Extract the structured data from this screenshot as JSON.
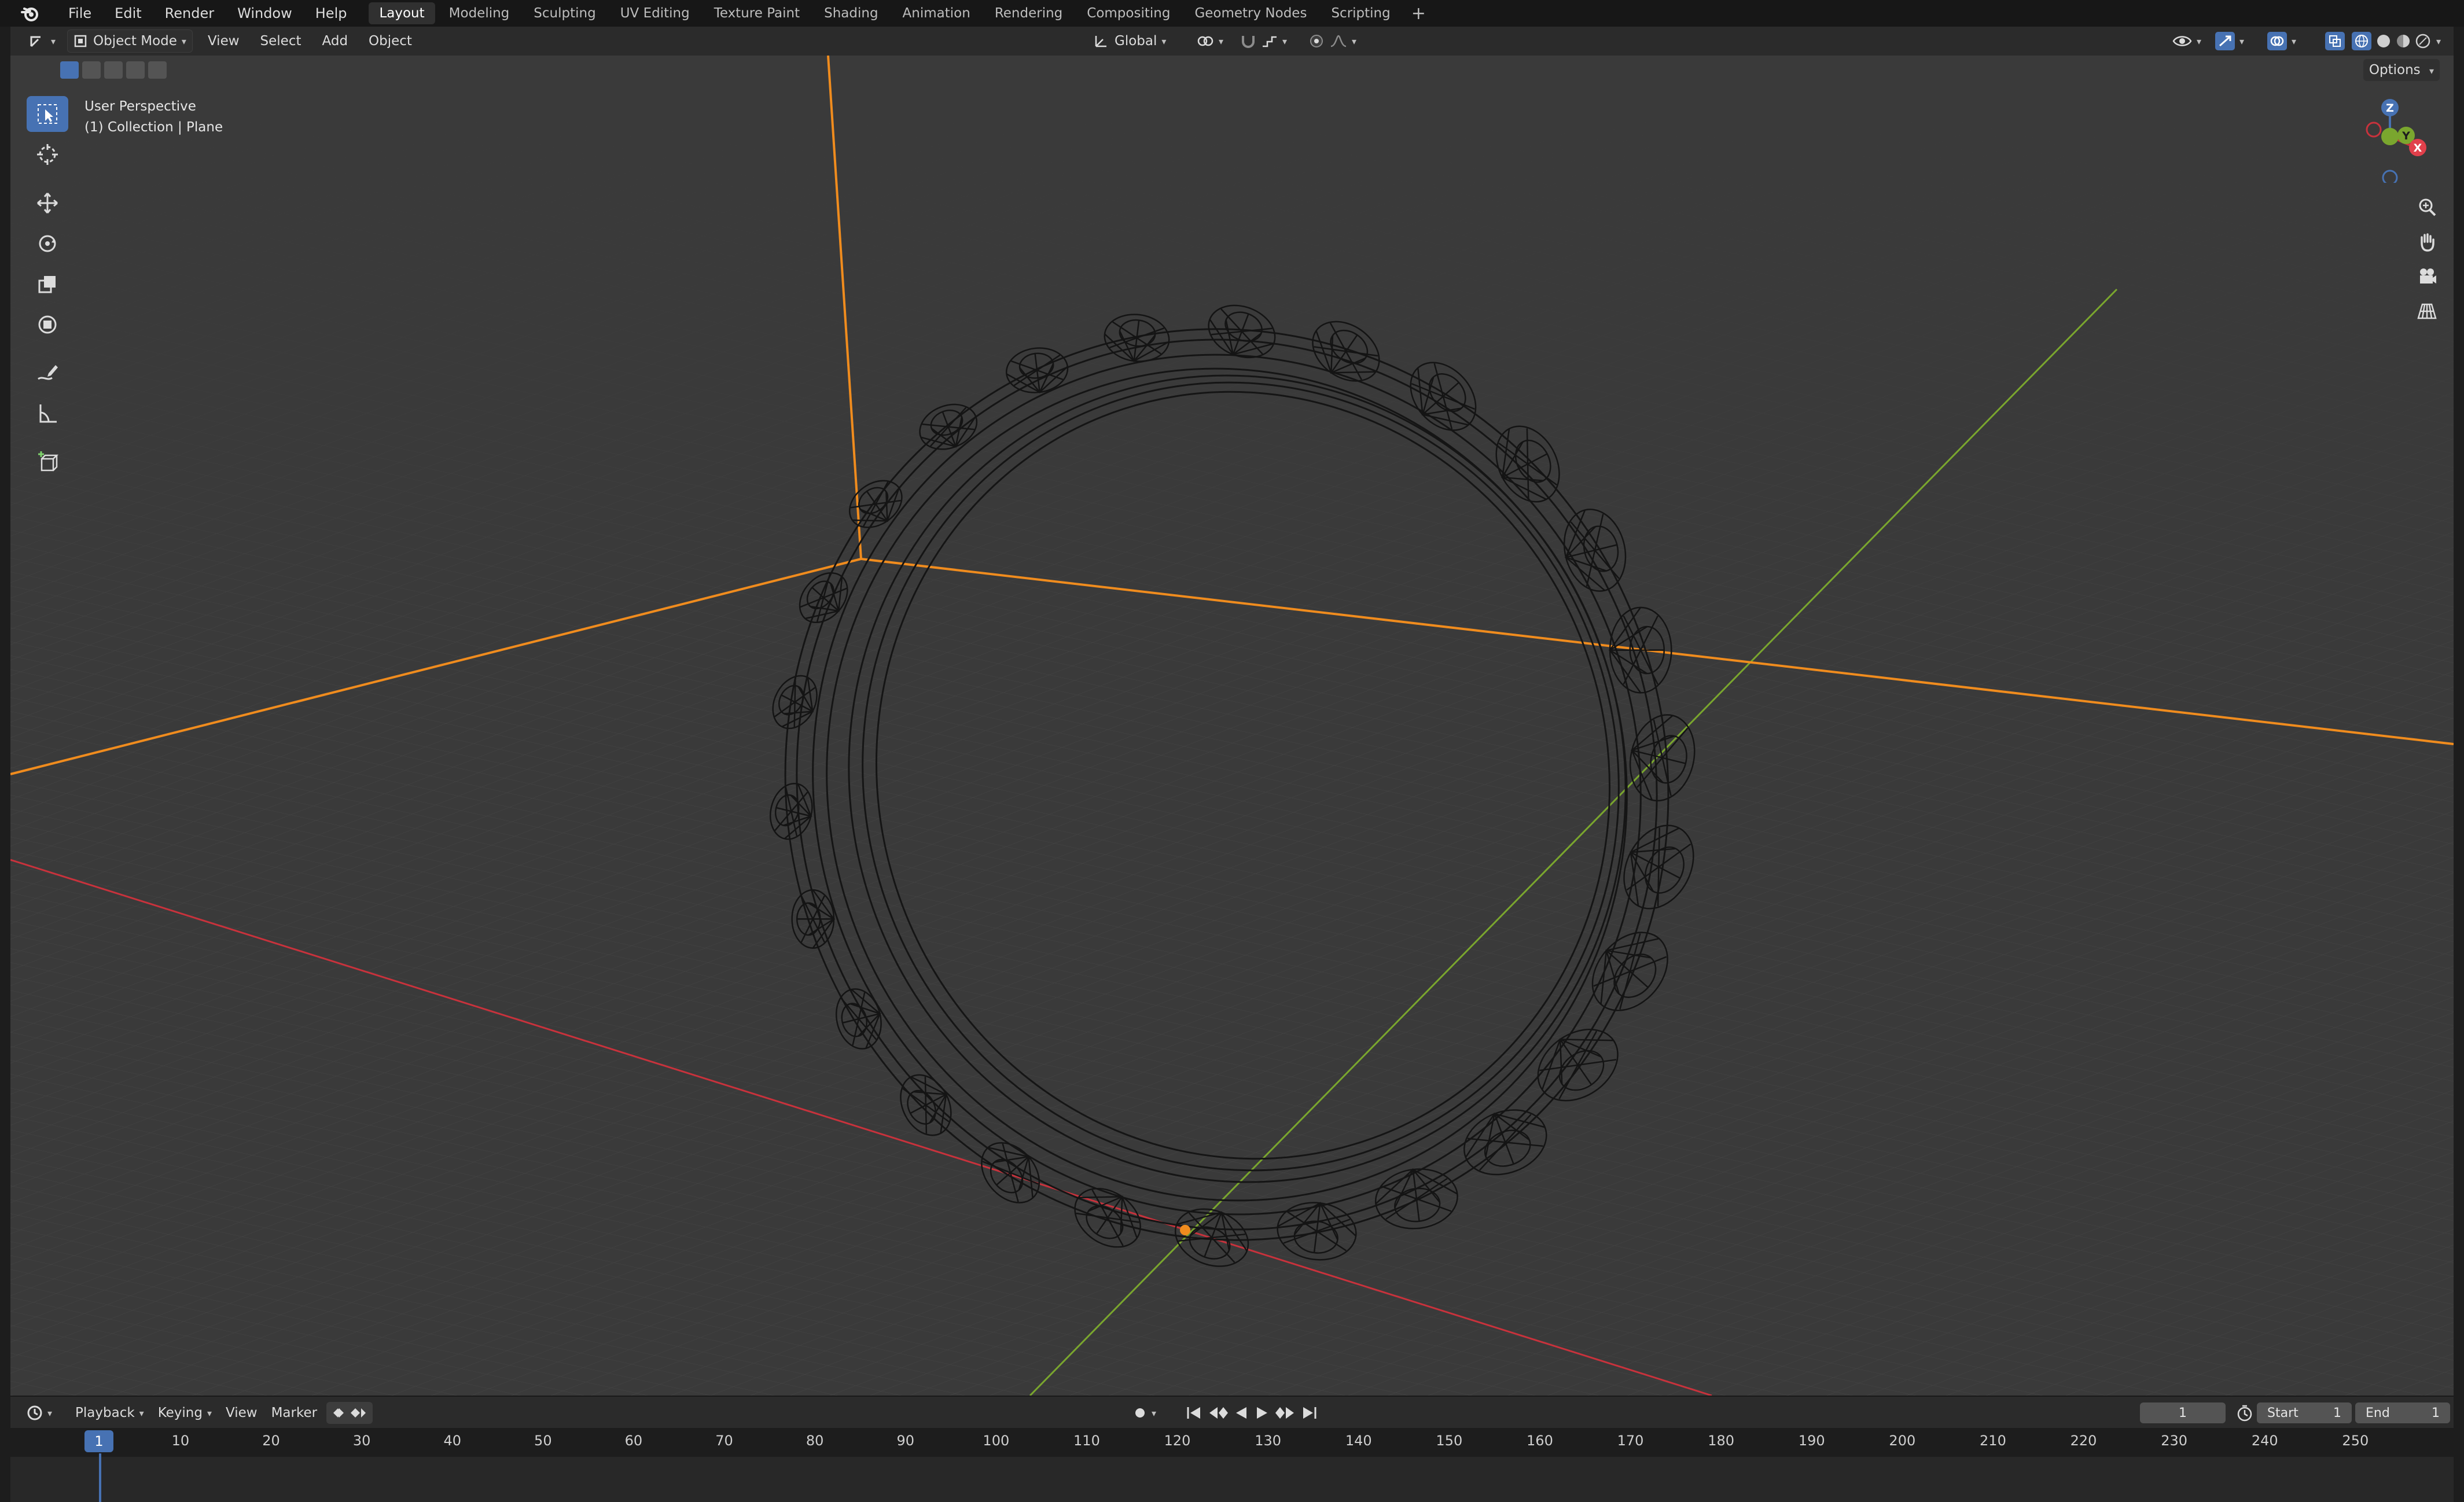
{
  "topbar": {
    "menus": [
      "File",
      "Edit",
      "Render",
      "Window",
      "Help"
    ],
    "workspaces": [
      "Layout",
      "Modeling",
      "Sculpting",
      "UV Editing",
      "Texture Paint",
      "Shading",
      "Animation",
      "Rendering",
      "Compositing",
      "Geometry Nodes",
      "Scripting"
    ],
    "active_workspace": "Layout",
    "add_label": "+"
  },
  "header": {
    "mode": "Object Mode",
    "menus": [
      "View",
      "Select",
      "Add",
      "Object"
    ],
    "orientation": "Global",
    "options": "Options"
  },
  "viewport": {
    "perspective": "User Perspective",
    "collection": "(1) Collection | Plane"
  },
  "gizmo": {
    "x": "X",
    "y": "Y",
    "z": "Z"
  },
  "timeline": {
    "menus": [
      "Playback",
      "Keying",
      "View",
      "Marker"
    ],
    "current_frame": "1",
    "start_label": "Start",
    "start_value": "1",
    "end_label": "End",
    "end_value": "1",
    "ruler": [
      "1",
      "10",
      "20",
      "30",
      "40",
      "50",
      "60",
      "70",
      "80",
      "90",
      "100",
      "110",
      "120",
      "130",
      "140",
      "150",
      "160",
      "170",
      "180",
      "190",
      "200",
      "210",
      "220",
      "230",
      "240",
      "250"
    ]
  },
  "colors": {
    "accent": "#4772b3",
    "x_axis": "#c8323c",
    "y_axis": "#7aa62e",
    "selection": "#f08c1e"
  }
}
